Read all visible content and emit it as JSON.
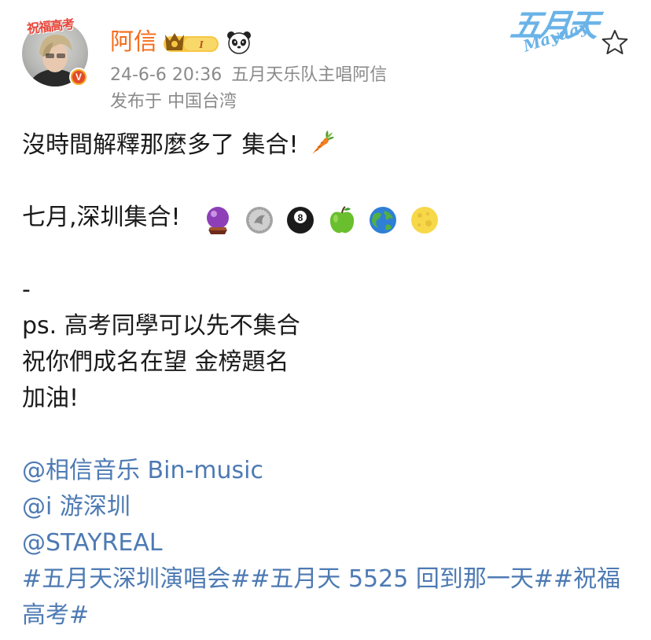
{
  "author": {
    "name": "阿信",
    "avatar_frame_text": "祝福高考",
    "verified_mark": "V",
    "vip_level": "I"
  },
  "meta": {
    "timestamp": "24-6-6 20:36",
    "bio": "五月天乐队主唱阿信",
    "location": "发布于 中国台湾"
  },
  "brand_logo": {
    "cn": "五月天",
    "en": "Mayday"
  },
  "post": {
    "line1": "沒時間解釋那麼多了 集合!",
    "line2": "七月,深圳集合!",
    "line3": "-",
    "line4": "ps. 高考同學可以先不集合",
    "line5": "祝你們成名在望 金榜題名",
    "line6": "加油!",
    "mention1": "@相信音乐 Bin-music",
    "mention2": "@i 游深圳",
    "mention3": "@STAYREAL",
    "hashtags_line1": "#五月天深圳演唱会##五月天 5525 回到那一天##祝福",
    "hashtags_line2": "高考#"
  },
  "emojis": [
    "carrot-emoji",
    "crystal-ball-emoji",
    "coin-emoji",
    "eight-ball-emoji",
    "green-apple-emoji",
    "globe-emoji",
    "full-moon-emoji"
  ],
  "colors": {
    "username": "#f56b1a",
    "meta": "#8a8a8a",
    "link": "#4d7ab3",
    "logo": "#6ab3e8"
  }
}
